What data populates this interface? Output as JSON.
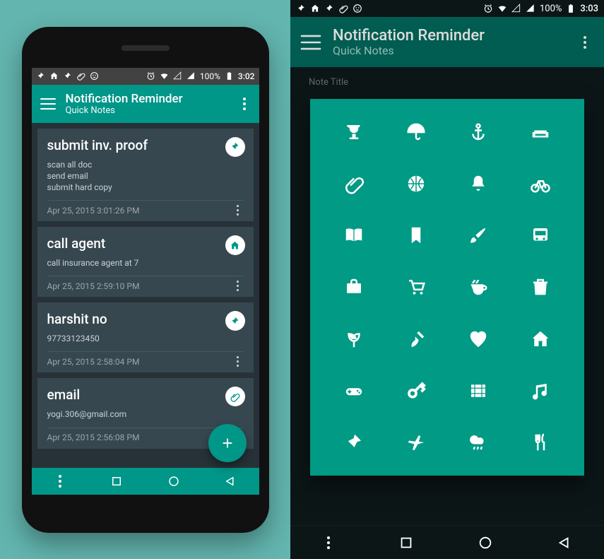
{
  "left": {
    "status": {
      "battery": "100%",
      "time": "3:02"
    },
    "appbar": {
      "title": "Notification Reminder",
      "subtitle": "Quick Notes"
    },
    "notes": [
      {
        "title": "submit inv. proof",
        "body": "scan all doc\nsend email\nsubmit hard copy",
        "time": "Apr 25, 2015 3:01:26 PM",
        "icon": "pin-icon"
      },
      {
        "title": "call agent",
        "body": "call insurance agent at 7",
        "time": "Apr 25, 2015 2:59:10 PM",
        "icon": "home-icon"
      },
      {
        "title": "harshit no",
        "body": "97733123450",
        "time": "Apr 25, 2015 2:58:04 PM",
        "icon": "pin-icon"
      },
      {
        "title": "email",
        "body": "yogi.306@gmail.com",
        "time": "Apr 25, 2015 2:56:08 PM",
        "icon": "paperclip-icon"
      }
    ]
  },
  "right": {
    "status": {
      "battery": "100%",
      "time": "3:03"
    },
    "appbar": {
      "title": "Notification Reminder",
      "subtitle": "Quick Notes"
    },
    "note_hint": "Note Title",
    "icons": [
      "trophy-icon",
      "umbrella-icon",
      "anchor-icon",
      "sofa-icon",
      "paperclip-icon",
      "basketball-icon",
      "bell-icon",
      "bicycle-icon",
      "book-icon",
      "bookmark-icon",
      "brush-icon",
      "bus-icon",
      "briefcase-icon",
      "cart-icon",
      "coffee-icon",
      "trash-icon",
      "leaf-icon",
      "guitar-icon",
      "heart-icon",
      "home-icon",
      "gamepad-icon",
      "key-icon",
      "film-icon",
      "music-icon",
      "pin-icon",
      "plane-icon",
      "rain-icon",
      "cutlery-icon"
    ]
  }
}
